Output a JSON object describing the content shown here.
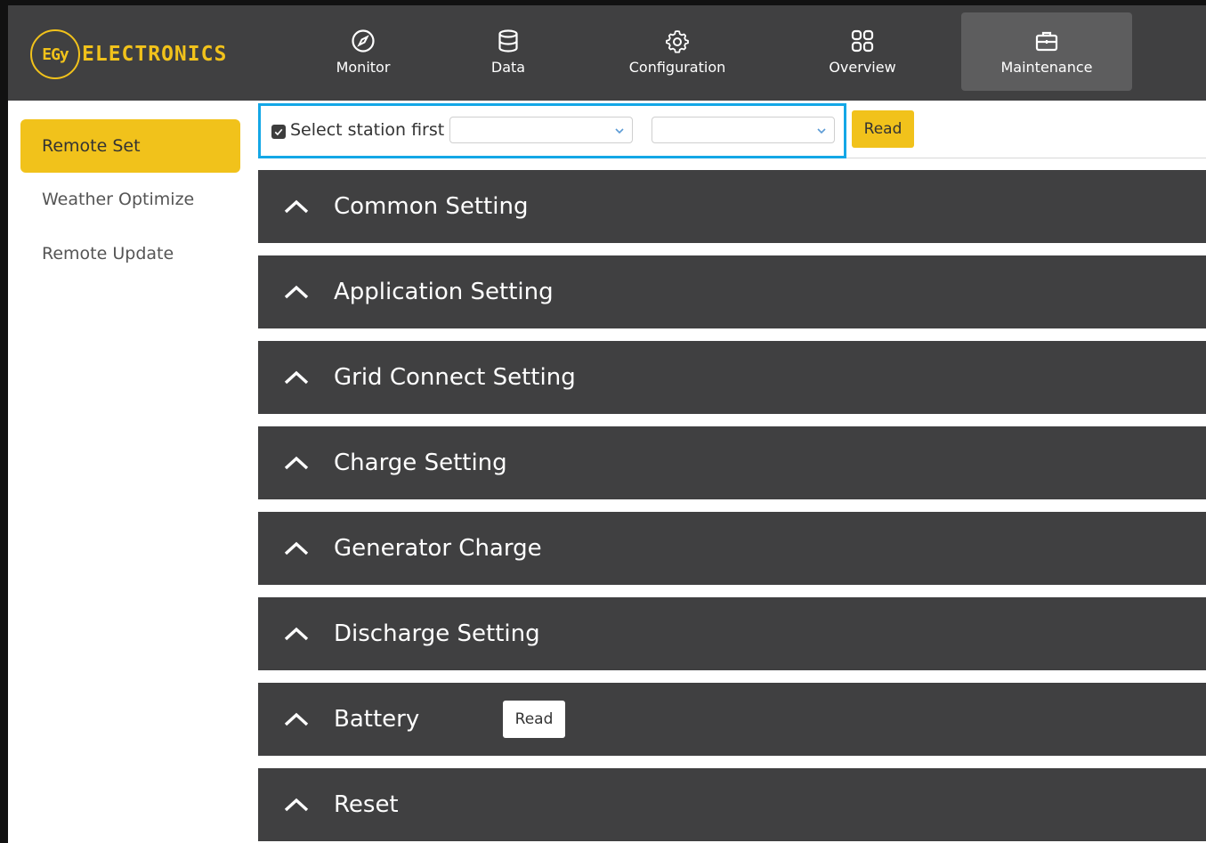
{
  "brand": {
    "logo_mark": "EGy",
    "logo_text": "ELECTRONICS",
    "accent_color": "#f1c21b"
  },
  "nav": {
    "items": [
      {
        "label": "Monitor",
        "icon": "compass-icon"
      },
      {
        "label": "Data",
        "icon": "database-icon"
      },
      {
        "label": "Configuration",
        "icon": "gear-icon"
      },
      {
        "label": "Overview",
        "icon": "grid-icon"
      },
      {
        "label": "Maintenance",
        "icon": "briefcase-icon",
        "active": true
      }
    ]
  },
  "sidebar": {
    "items": [
      {
        "label": "Remote Set",
        "active": true
      },
      {
        "label": "Weather Optimize"
      },
      {
        "label": "Remote Update"
      }
    ]
  },
  "toolbar": {
    "checkbox_label": "Select station first",
    "checkbox_checked": true,
    "station_select_value": "",
    "device_select_value": "",
    "read_label": "Read",
    "highlight_color": "#14a7e6"
  },
  "sections": [
    {
      "title": "Common Setting"
    },
    {
      "title": "Application Setting"
    },
    {
      "title": "Grid Connect Setting"
    },
    {
      "title": "Charge Setting"
    },
    {
      "title": "Generator Charge"
    },
    {
      "title": "Discharge Setting"
    },
    {
      "title": "Battery",
      "read_label": "Read"
    },
    {
      "title": "Reset"
    }
  ]
}
